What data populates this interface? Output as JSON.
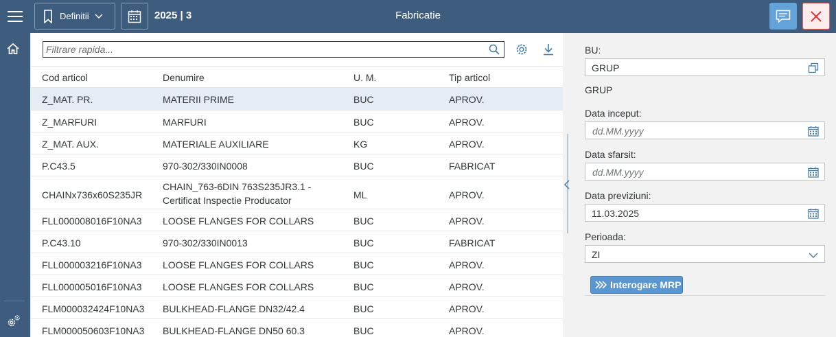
{
  "header": {
    "definitions_label": "Definitii",
    "period": "2025 | 3",
    "title": "Fabricatie"
  },
  "icons": {
    "menu": "hamburger-icon",
    "bookmark": "bookmark-icon",
    "calendar": "calendar-icon",
    "chat": "chat-icon",
    "close": "close-icon",
    "home": "home-icon",
    "settings": "settings-icon",
    "search": "search-icon",
    "gear": "gear-icon",
    "download": "download-icon",
    "value_help": "value-help-icon",
    "dropdown": "chevron-down-icon",
    "collapse": "chevron-left-icon"
  },
  "colors": {
    "shell": "#3e5c7d",
    "accent": "#64a3d8",
    "selected_row": "#e5ecf3",
    "close_border": "#e06666",
    "primary_button": "#5a97d0"
  },
  "search": {
    "placeholder": "Filtrare rapida..."
  },
  "table": {
    "columns": [
      "Cod articol",
      "Denumire",
      "U. M.",
      "Tip articol"
    ],
    "rows": [
      {
        "cod": "Z_MAT. PR.",
        "denumire": "MATERII PRIME",
        "um": "BUC",
        "tip": "APROV."
      },
      {
        "cod": "Z_MARFURI",
        "denumire": "MARFURI",
        "um": "BUC",
        "tip": "APROV."
      },
      {
        "cod": "Z_MAT. AUX.",
        "denumire": "MATERIALE AUXILIARE",
        "um": "KG",
        "tip": "APROV."
      },
      {
        "cod": "P.C43.5",
        "denumire": "970-302/330IN0008",
        "um": "BUC",
        "tip": "FABRICAT"
      },
      {
        "cod": "CHAINx736x60S235JR",
        "denumire": "CHAIN_763-6DIN 763S235JR3.1 - Certificat Inspectie Producator",
        "um": "ML",
        "tip": "APROV."
      },
      {
        "cod": "FLL000008016F10NA3",
        "denumire": "LOOSE FLANGES FOR COLLARS",
        "um": "BUC",
        "tip": "APROV."
      },
      {
        "cod": "P.C43.10",
        "denumire": "970-302/330IN0013",
        "um": "BUC",
        "tip": "FABRICAT"
      },
      {
        "cod": "FLL000003216F10NA3",
        "denumire": "LOOSE FLANGES FOR COLLARS",
        "um": "BUC",
        "tip": "APROV."
      },
      {
        "cod": "FLL000005016F10NA3",
        "denumire": "LOOSE FLANGES FOR COLLARS",
        "um": "BUC",
        "tip": "APROV."
      },
      {
        "cod": "FLM000032424F10NA3",
        "denumire": "BULKHEAD-FLANGE DN32/42.4",
        "um": "BUC",
        "tip": "APROV."
      },
      {
        "cod": "FLM000050603F10NA3",
        "denumire": "BULKHEAD-FLANGE DN50 60.3",
        "um": "BUC",
        "tip": "APROV."
      }
    ]
  },
  "form": {
    "bu_label": "BU:",
    "bu_value": "GRUP",
    "bu_description": "GRUP",
    "start_label": "Data inceput:",
    "start_placeholder": "dd.MM.yyyy",
    "end_label": "Data sfarsit:",
    "end_placeholder": "dd.MM.yyyy",
    "forecast_label": "Data previziuni:",
    "forecast_value": "11.03.2025",
    "period_label": "Perioada:",
    "period_value": "ZI",
    "mrp_button": "Interogare MRP"
  }
}
